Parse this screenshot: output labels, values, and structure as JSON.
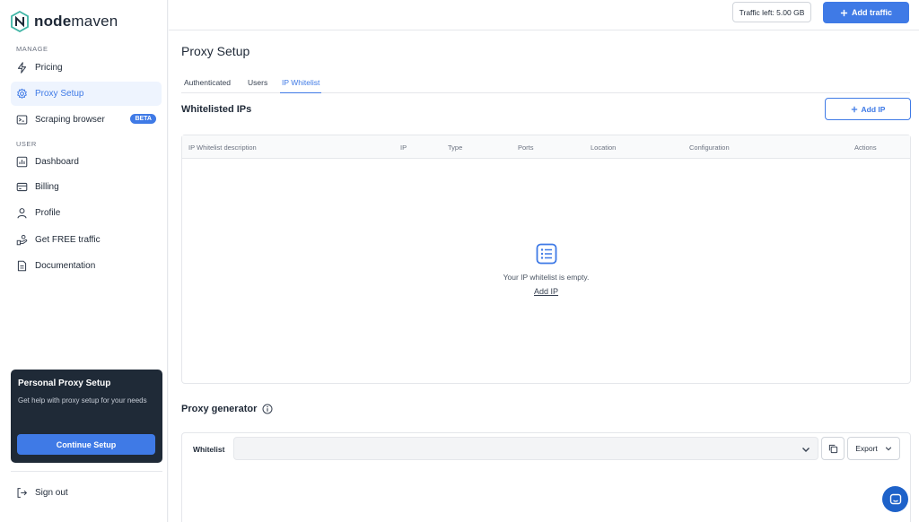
{
  "brand": {
    "name_bold": "node",
    "name_rest": "maven",
    "color": "#3f7ae6"
  },
  "sidebar": {
    "manage_label": "MANAGE",
    "user_label": "USER",
    "items": [
      {
        "label": "Pricing",
        "icon": "bolt-icon"
      },
      {
        "label": "Proxy Setup",
        "icon": "gear-icon",
        "active": true
      },
      {
        "label": "Scraping browser",
        "icon": "terminal-icon",
        "badge": "BETA"
      },
      {
        "label": "Dashboard",
        "icon": "chart-icon"
      },
      {
        "label": "Billing",
        "icon": "card-icon"
      },
      {
        "label": "Profile",
        "icon": "user-icon"
      },
      {
        "label": "Get FREE traffic",
        "icon": "gift-icon"
      },
      {
        "label": "Documentation",
        "icon": "document-icon"
      }
    ],
    "promo": {
      "title": "Personal Proxy Setup",
      "text": "Get help with proxy setup for your needs",
      "button": "Continue Setup"
    },
    "sign_out": "Sign out"
  },
  "topbar": {
    "traffic_left": "Traffic left: 5.00 GB",
    "add_traffic": "Add traffic"
  },
  "main": {
    "title": "Proxy Setup",
    "tabs": [
      {
        "label": "Authenticated"
      },
      {
        "label": "Users"
      },
      {
        "label": "IP Whitelist",
        "active": true
      }
    ],
    "whitelist_title": "Whitelisted IPs",
    "add_ip_button": "Add IP",
    "table": {
      "columns": [
        "IP Whitelist description",
        "IP",
        "Type",
        "Ports",
        "Location",
        "Configuration",
        "Actions"
      ],
      "empty_text": "Your IP whitelist is empty.",
      "empty_link": "Add IP"
    },
    "generator": {
      "title": "Proxy generator",
      "label": "Whitelist",
      "select_value": "",
      "export": "Export"
    }
  }
}
